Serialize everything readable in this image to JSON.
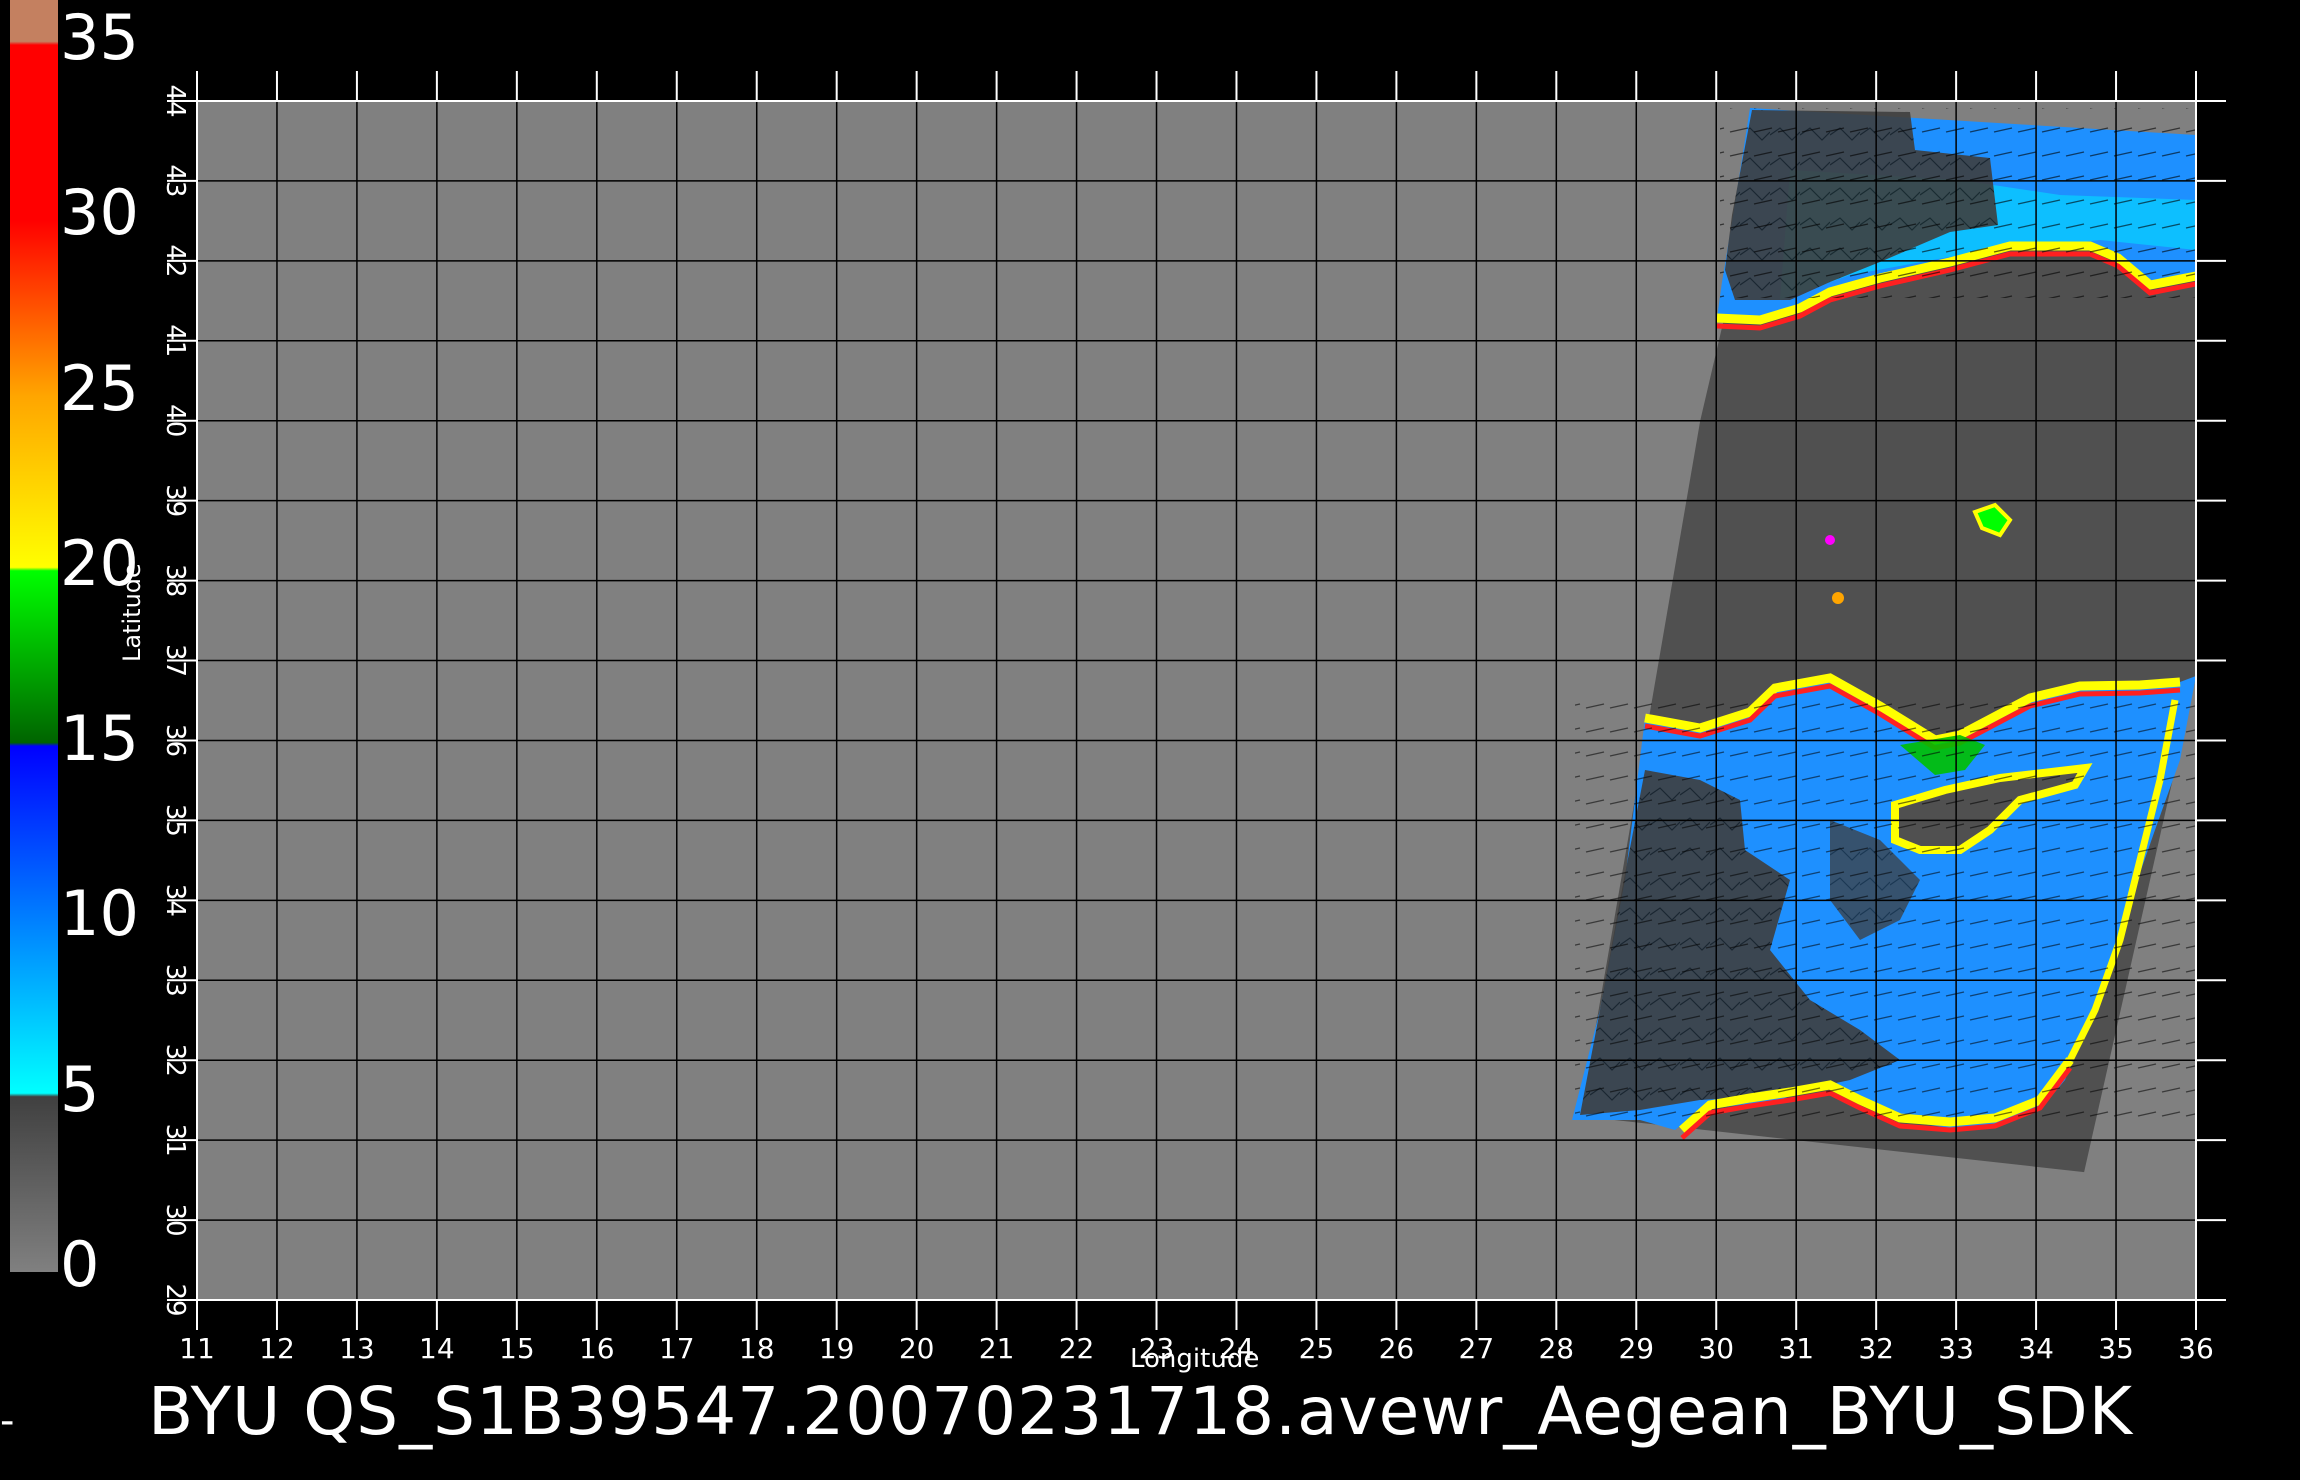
{
  "chart_data": {
    "type": "heatmap",
    "title": "BYU  QS_S1B39547.20070231718.avewr_Aegean_BYU_SDK",
    "xlabel": "Longitude",
    "ylabel": "Latitude",
    "xlim": [
      11,
      36
    ],
    "ylim": [
      29,
      44
    ],
    "x_ticks": [
      "11",
      "12",
      "13",
      "14",
      "15",
      "16",
      "17",
      "18",
      "19",
      "20",
      "21",
      "22",
      "23",
      "24",
      "25",
      "26",
      "27",
      "28",
      "29",
      "30",
      "31",
      "32",
      "33",
      "34",
      "35",
      "36"
    ],
    "y_ticks": [
      "29",
      "30",
      "31",
      "32",
      "33",
      "34",
      "35",
      "36",
      "37",
      "38",
      "39",
      "40",
      "41",
      "42",
      "43",
      "44"
    ],
    "colorbar": {
      "ticks": [
        "0",
        "5",
        "10",
        "15",
        "20",
        "25",
        "30",
        "35"
      ],
      "range": [
        0,
        35
      ],
      "stops": [
        {
          "value": 0,
          "color": "#808080"
        },
        {
          "value": 5,
          "color": "#404040"
        },
        {
          "value": 5.1,
          "color": "#00ffff"
        },
        {
          "value": 15,
          "color": "#0000ff"
        },
        {
          "value": 15.1,
          "color": "#006400"
        },
        {
          "value": 20,
          "color": "#00ff00"
        },
        {
          "value": 20.1,
          "color": "#ffff00"
        },
        {
          "value": 25,
          "color": "#ffa500"
        },
        {
          "value": 30,
          "color": "#ff0000"
        },
        {
          "value": 35,
          "color": "#ff0000"
        },
        {
          "value": 35.1,
          "color": "#c48060"
        }
      ]
    },
    "grid": true,
    "swath": {
      "polygon": [
        [
          30.5,
          43.0
        ],
        [
          36.0,
          42.7
        ],
        [
          36.0,
          36.8
        ],
        [
          34.6,
          30.6
        ],
        [
          28.3,
          31.3
        ],
        [
          29.8,
          40.0
        ]
      ],
      "land_color": "#505050",
      "ocean_color": "#1e90ff",
      "coast_colors": [
        "#ffff00",
        "#ff0000",
        "#ff00ff"
      ]
    }
  },
  "colors": {
    "background": "#000000",
    "plot_area": "#808080",
    "grid": "#000000",
    "axes": "#ffffff"
  },
  "footer": {
    "title": "BYU  QS_S1B39547.20070231718.avewr_Aegean_BYU_SDK",
    "dash": "-"
  }
}
